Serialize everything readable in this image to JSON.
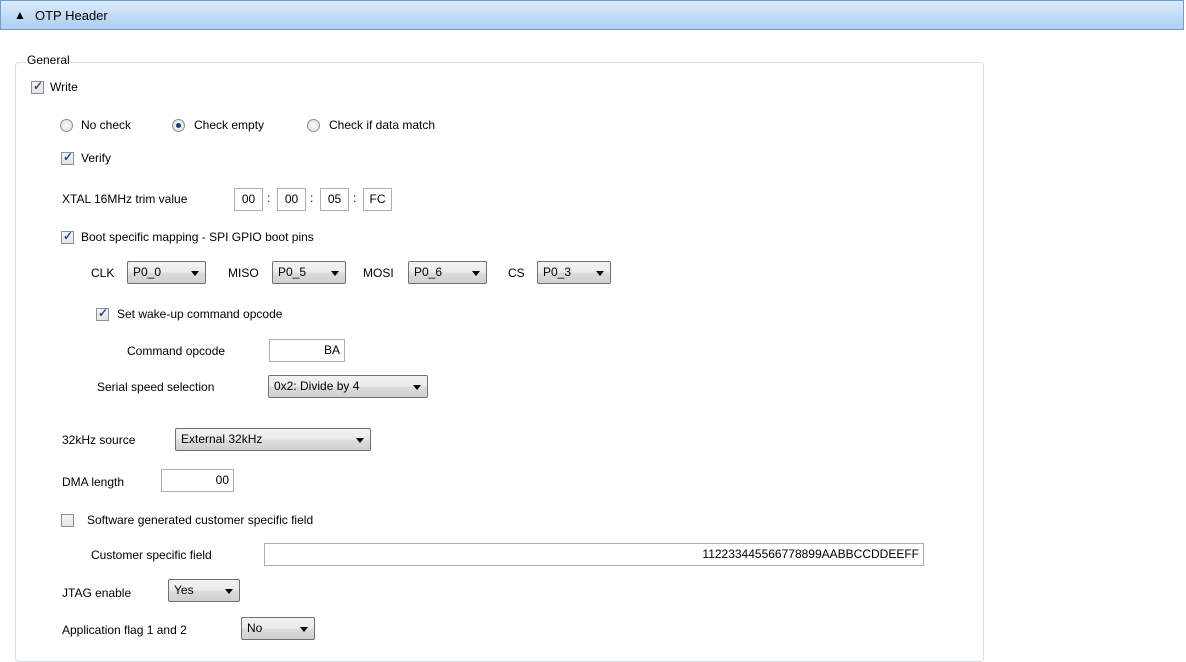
{
  "header": {
    "title": "OTP Header",
    "toggle_icon": "triangle-up"
  },
  "general": {
    "legend": "General",
    "write": {
      "label": "Write",
      "checked": true
    },
    "check_mode": {
      "options": [
        "No check",
        "Check empty",
        "Check if data match"
      ],
      "selected": "Check empty"
    },
    "verify": {
      "label": "Verify",
      "checked": true
    },
    "xtal": {
      "label": "XTAL 16MHz trim value",
      "values": [
        "00",
        "00",
        "05",
        "FC"
      ],
      "separator": ":"
    },
    "boot_mapping": {
      "label": "Boot specific mapping - SPI GPIO boot pins",
      "checked": true,
      "clk": {
        "label": "CLK",
        "value": "P0_0"
      },
      "miso": {
        "label": "MISO",
        "value": "P0_5"
      },
      "mosi": {
        "label": "MOSI",
        "value": "P0_6"
      },
      "cs": {
        "label": "CS",
        "value": "P0_3"
      }
    },
    "wakeup": {
      "label": "Set wake-up command opcode",
      "checked": true
    },
    "command_opcode": {
      "label": "Command opcode",
      "value": "BA"
    },
    "serial_speed": {
      "label": "Serial speed selection",
      "value": "0x2: Divide by 4"
    },
    "source_32k": {
      "label": "32kHz source",
      "value": "External 32kHz"
    },
    "dma_length": {
      "label": "DMA length",
      "value": "00"
    },
    "sw_customer": {
      "label": "Software generated customer specific field",
      "checked": false
    },
    "customer_field": {
      "label": "Customer specific field",
      "value": "112233445566778899AABBCCDDEEFF"
    },
    "jtag": {
      "label": "JTAG enable",
      "value": "Yes"
    },
    "app_flag": {
      "label": "Application flag 1 and 2",
      "value": "No"
    }
  }
}
